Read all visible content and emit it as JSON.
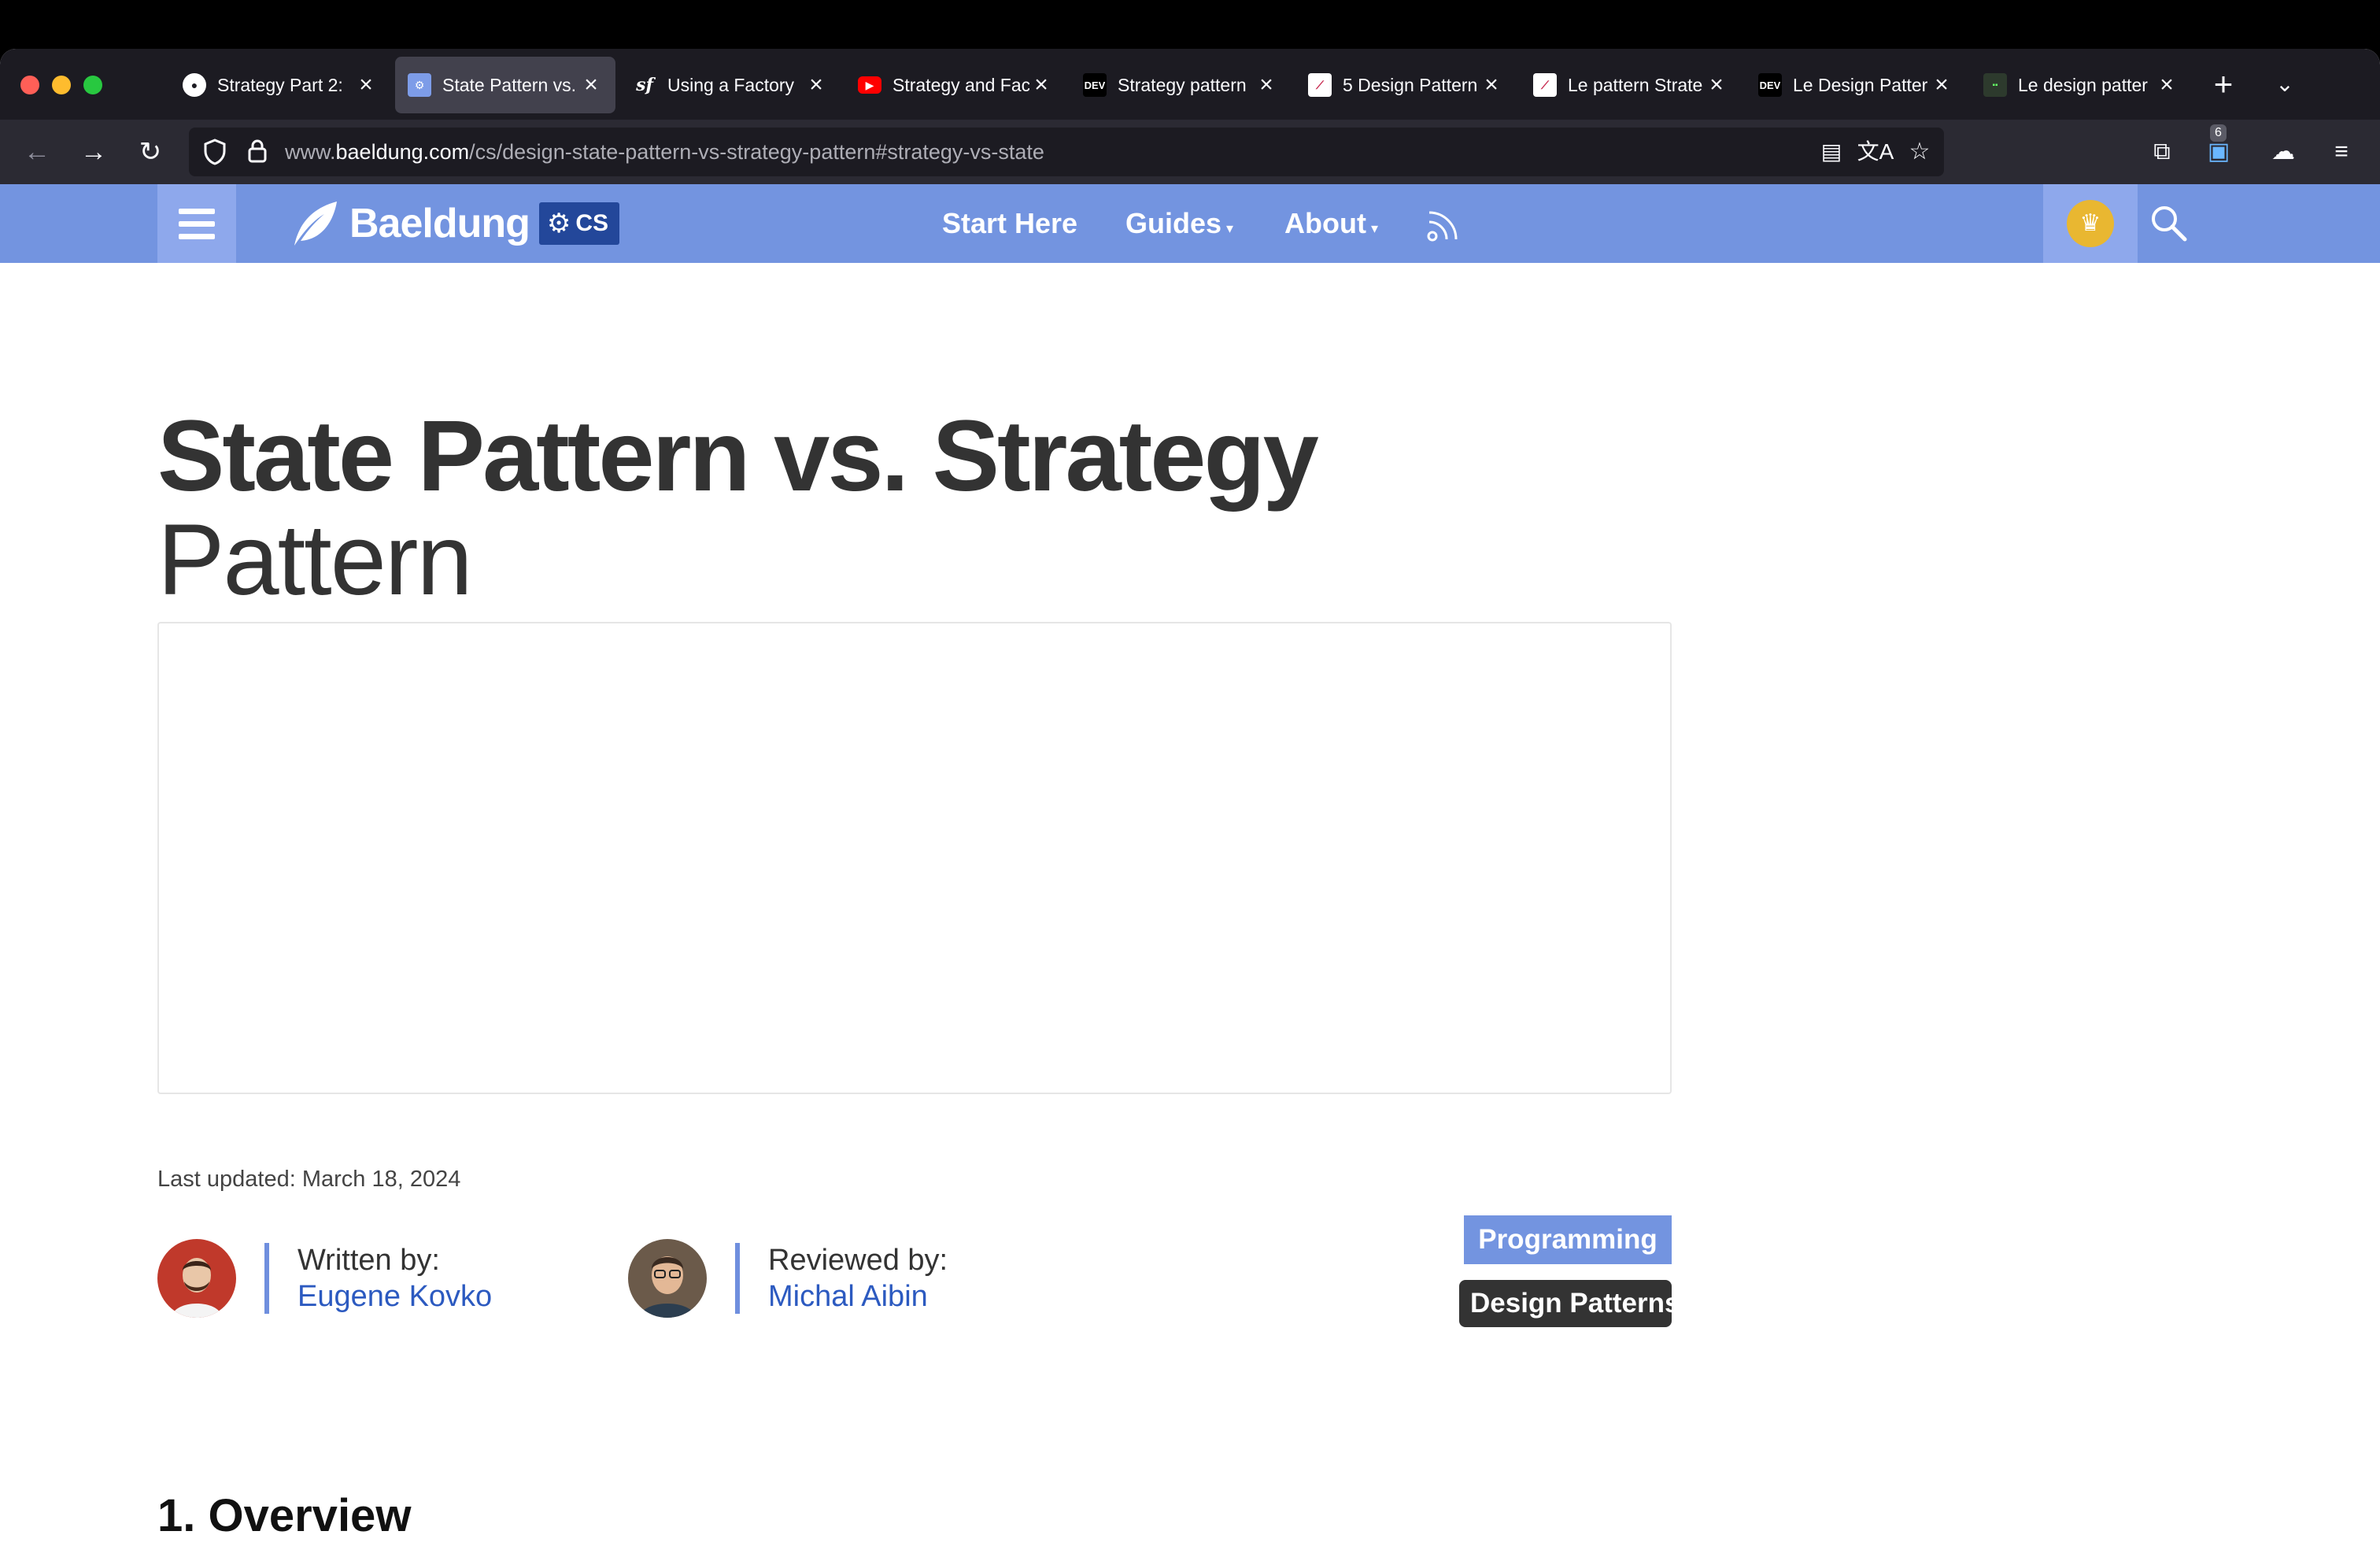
{
  "browser": {
    "tabs": [
      {
        "favicon": "github-icon",
        "title": "Strategy Part 2:",
        "active": false
      },
      {
        "favicon": "baeldung-icon",
        "title": "State Pattern vs.",
        "active": true
      },
      {
        "favicon": "symfony-icon",
        "title": "Using a Factory",
        "active": false
      },
      {
        "favicon": "youtube-icon",
        "title": "Strategy and Fac",
        "active": false
      },
      {
        "favicon": "dev-icon",
        "title": "Strategy pattern",
        "active": false
      },
      {
        "favicon": "leaf-icon",
        "title": "5 Design Pattern",
        "active": false
      },
      {
        "favicon": "leaf-icon",
        "title": "Le pattern Strate",
        "active": false
      },
      {
        "favicon": "dev-icon",
        "title": "Le Design Patter",
        "active": false
      },
      {
        "favicon": "terminal-icon",
        "title": "Le design patter",
        "active": false
      }
    ],
    "url": {
      "prefix": "www.",
      "domain": "baeldung.com",
      "path": "/cs/design-state-pattern-vs-strategy-pattern#strategy-vs-state"
    },
    "extension_badge": "6"
  },
  "site": {
    "logo_text": "Baeldung",
    "logo_badge": "CS",
    "nav": {
      "start_here": "Start Here",
      "guides": "Guides",
      "about": "About"
    }
  },
  "article": {
    "title_bold": "State Pattern vs. Strategy",
    "title_light": "Pattern",
    "last_updated": "Last updated: March 18, 2024",
    "author_label": "Written by:",
    "author_name": "Eugene Kovko",
    "reviewer_label": "Reviewed by:",
    "reviewer_name": "Michal Aibin",
    "tags": [
      "Programming",
      "Design Patterns"
    ],
    "section_heading": "1. Overview"
  },
  "colors": {
    "brand_blue": "#7394e0",
    "link_blue": "#2c5ac0",
    "premium_gold": "#e9b731"
  }
}
